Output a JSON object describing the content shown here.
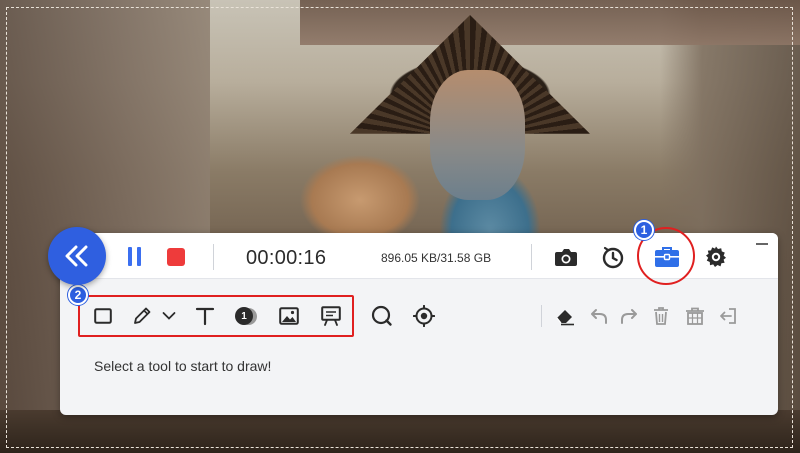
{
  "recording": {
    "elapsed": "00:00:16",
    "file_size": "896.05 KB/31.58 GB"
  },
  "hint": {
    "text": "Select a tool to start to draw!"
  },
  "badges": {
    "step1": "1",
    "step2": "2",
    "number_tool": "1"
  },
  "colors": {
    "accent_blue": "#2f5fe0",
    "stop_red": "#ee3b3b",
    "highlight_red": "#e02020"
  },
  "icons": {
    "collapse": "double-chevron-left-icon",
    "pause": "pause-icon",
    "stop": "stop-icon",
    "screenshot": "camera-icon",
    "schedule": "clock-icon",
    "toolbox": "toolbox-icon",
    "settings": "gear-icon",
    "rectangle": "rectangle-icon",
    "pen": "pen-icon",
    "pen_dropdown": "chevron-down-icon",
    "text": "text-icon",
    "number": "number-icon",
    "image": "image-icon",
    "whiteboard": "whiteboard-icon",
    "magnifier": "magnifier-icon",
    "spotlight": "spotlight-icon",
    "eraser": "eraser-icon",
    "undo": "undo-icon",
    "redo": "redo-icon",
    "delete": "trash-icon",
    "clear": "clear-all-icon",
    "exit": "exit-icon",
    "minimize": "minimize-icon"
  }
}
